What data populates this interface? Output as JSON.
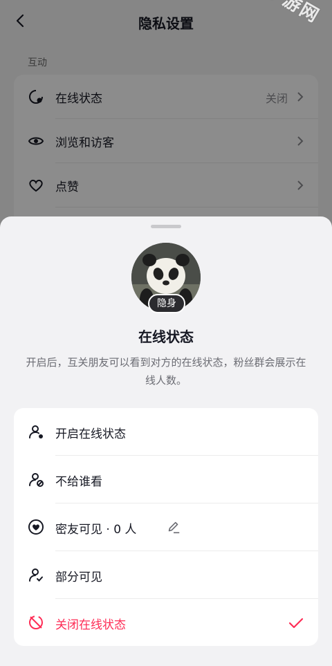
{
  "watermark": "新华手游网",
  "nav": {
    "title": "隐私设置"
  },
  "section": {
    "label": "互动"
  },
  "bg_rows": [
    {
      "label": "在线状态",
      "value": "关闭",
      "icon": "online-status-icon"
    },
    {
      "label": "浏览和访客",
      "value": "",
      "icon": "eye-icon"
    },
    {
      "label": "点赞",
      "value": "",
      "icon": "heart-icon"
    }
  ],
  "sheet": {
    "badge": "隐身",
    "title": "在线状态",
    "description": "开启后，互关朋友可以看到对方的在线状态，粉丝群会展示在线人数。"
  },
  "options": [
    {
      "label": "开启在线状态",
      "icon": "user-online-icon"
    },
    {
      "label": "不给谁看",
      "icon": "user-blocked-icon"
    },
    {
      "label": "密友可见 · 0 人",
      "icon": "heart-circle-icon",
      "editable": true
    },
    {
      "label": "部分可见",
      "icon": "user-check-icon"
    },
    {
      "label": "关闭在线状态",
      "icon": "offline-icon",
      "selected": true
    }
  ],
  "colors": {
    "accent": "#fe2c55",
    "text": "#161823",
    "secondary": "#8a8b91"
  }
}
